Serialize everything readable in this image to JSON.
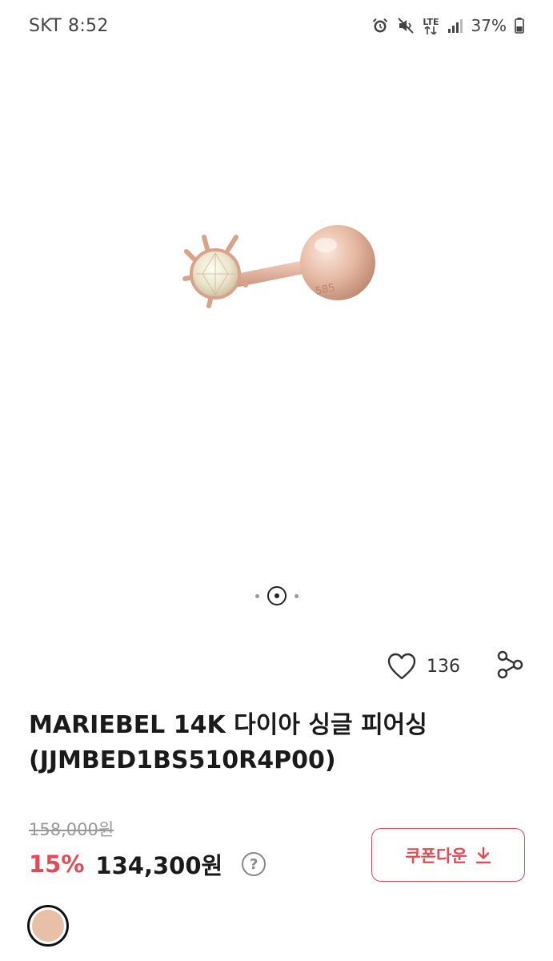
{
  "status_bar": {
    "carrier": "SKT",
    "time": "8:52",
    "network": "LTE",
    "battery": "37%",
    "icons": [
      "alarm-icon",
      "mute-icon",
      "lte-icon",
      "signal-icon",
      "battery-icon"
    ]
  },
  "product_image": {
    "alt": "rose gold diamond piercing",
    "engraving": "585"
  },
  "pager": {
    "total": 3,
    "current": 2
  },
  "actions": {
    "like_count": "136",
    "icons": [
      "heart-icon",
      "share-icon"
    ]
  },
  "product": {
    "title": "MARIEBEL 14K 다이아 싱글 피어싱 (JJMBED1BS510R4P00)",
    "original_price": "158,000원",
    "discount": "15%",
    "price": "134,300원",
    "help_symbol": "?"
  },
  "coupon": {
    "label": "쿠폰다운",
    "icon": "download-arrow-icon"
  },
  "colors": {
    "accent": "#e04b56",
    "swatch": "#e8c0a8"
  }
}
